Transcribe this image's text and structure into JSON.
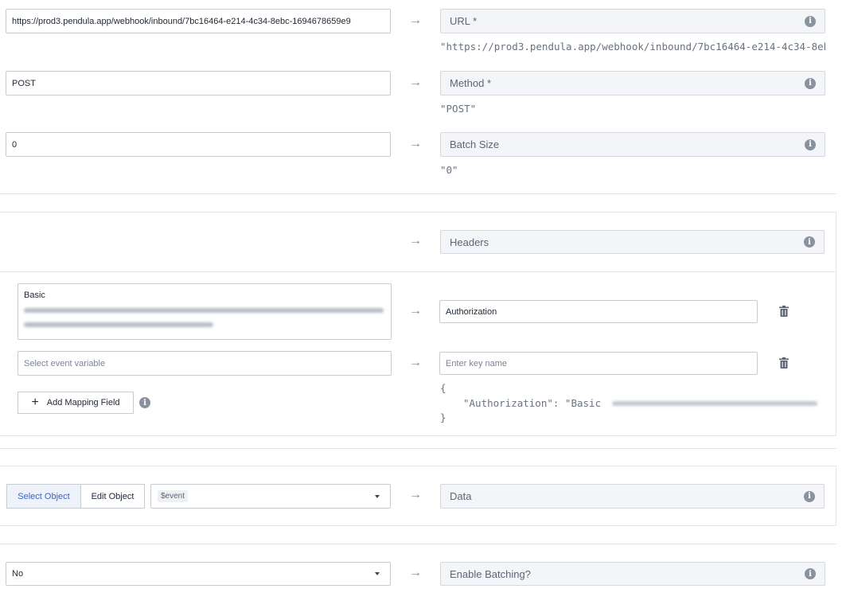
{
  "url_row": {
    "input_value": "https://prod3.pendula.app/webhook/inbound/7bc16464-e214-4c34-8ebc-1694678659e9",
    "label": "URL *",
    "preview": "\"https://prod3.pendula.app/webhook/inbound/7bc16464-e214-4c34-8eb"
  },
  "method_row": {
    "input_value": "POST",
    "label": "Method *",
    "preview": "\"POST\""
  },
  "batch_row": {
    "input_value": "0",
    "label": "Batch Size",
    "preview": "\"0\""
  },
  "headers": {
    "label": "Headers",
    "mappings": [
      {
        "value_prefix": "Basic",
        "key": "Authorization"
      }
    ],
    "new_mapping": {
      "variable_placeholder": "Select event variable",
      "key_placeholder": "Enter key name"
    },
    "add_button_label": "Add Mapping Field",
    "preview_open": "{",
    "preview_line": "\"Authorization\": \"Basic ",
    "preview_close": "}"
  },
  "data_row": {
    "select_object_label": "Select Object",
    "edit_object_label": "Edit Object",
    "selected_value": "$event",
    "label": "Data"
  },
  "batching_row": {
    "selected_value": "No",
    "label": "Enable Batching?"
  },
  "icons": {
    "arrow": "→",
    "info": "i",
    "plus": "+"
  },
  "colors": {
    "accent": "#3a63c8",
    "field_bg": "#f3f5f8",
    "icon_gray": "#8a929e"
  }
}
